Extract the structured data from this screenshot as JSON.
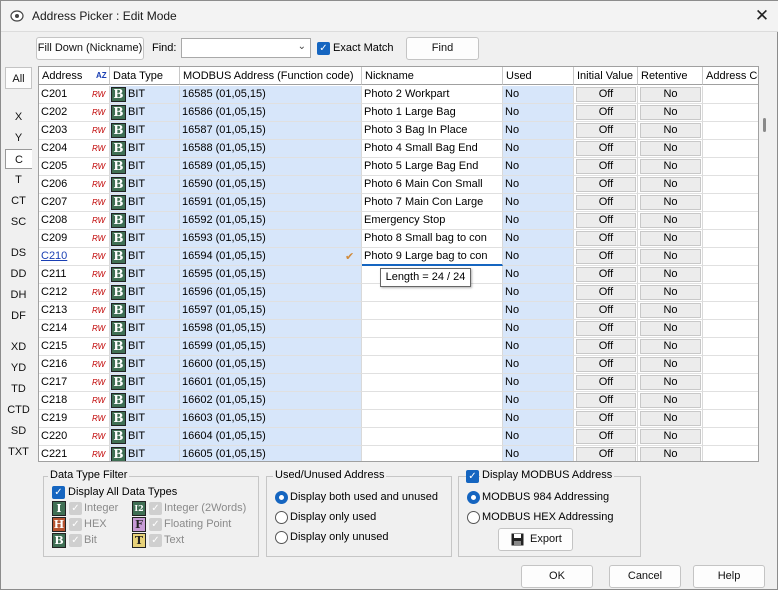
{
  "window": {
    "title": "Address Picker : Edit Mode",
    "close_glyph": "✕"
  },
  "toolbar": {
    "fill_down_label": "Fill Down (Nickname)",
    "find_label": "Find:",
    "find_value": "",
    "exact_match_label": "Exact Match",
    "exact_match_checked": true,
    "find_button_label": "Find"
  },
  "side_tabs": [
    "All",
    "X",
    "Y",
    "C",
    "T",
    "CT",
    "SC",
    "DS",
    "DD",
    "DH",
    "DF",
    "XD",
    "YD",
    "TD",
    "CTD",
    "SD",
    "TXT"
  ],
  "active_tab": "C",
  "grid": {
    "columns": [
      "Address",
      "Data Type",
      "MODBUS Address (Function code)",
      "Nickname",
      "Used",
      "Initial Value",
      "Retentive",
      "Address Co"
    ],
    "sort_icon": "AZ",
    "rw_badge": "RW",
    "type_icon_letter": "B",
    "rows": [
      {
        "address": "C201",
        "type": "BIT",
        "modbus": "16585 (01,05,15)",
        "nickname": "Photo 2 Workpart",
        "used": "No",
        "initial": "Off",
        "retentive": "No"
      },
      {
        "address": "C202",
        "type": "BIT",
        "modbus": "16586 (01,05,15)",
        "nickname": "Photo 1 Large Bag",
        "used": "No",
        "initial": "Off",
        "retentive": "No"
      },
      {
        "address": "C203",
        "type": "BIT",
        "modbus": "16587 (01,05,15)",
        "nickname": "Photo 3 Bag In Place",
        "used": "No",
        "initial": "Off",
        "retentive": "No"
      },
      {
        "address": "C204",
        "type": "BIT",
        "modbus": "16588 (01,05,15)",
        "nickname": "Photo 4 Small Bag End",
        "used": "No",
        "initial": "Off",
        "retentive": "No"
      },
      {
        "address": "C205",
        "type": "BIT",
        "modbus": "16589 (01,05,15)",
        "nickname": "Photo 5 Large Bag End",
        "used": "No",
        "initial": "Off",
        "retentive": "No"
      },
      {
        "address": "C206",
        "type": "BIT",
        "modbus": "16590 (01,05,15)",
        "nickname": "Photo 6 Main Con Small",
        "used": "No",
        "initial": "Off",
        "retentive": "No"
      },
      {
        "address": "C207",
        "type": "BIT",
        "modbus": "16591 (01,05,15)",
        "nickname": "Photo 7 Main Con Large",
        "used": "No",
        "initial": "Off",
        "retentive": "No"
      },
      {
        "address": "C208",
        "type": "BIT",
        "modbus": "16592 (01,05,15)",
        "nickname": "Emergency Stop",
        "used": "No",
        "initial": "Off",
        "retentive": "No"
      },
      {
        "address": "C209",
        "type": "BIT",
        "modbus": "16593 (01,05,15)",
        "nickname": "Photo 8 Small bag to con",
        "used": "No",
        "initial": "Off",
        "retentive": "No"
      },
      {
        "address": "C210",
        "type": "BIT",
        "modbus": "16594 (01,05,15)",
        "nickname": "Photo 9 Large bag to con",
        "used": "No",
        "initial": "Off",
        "retentive": "No"
      },
      {
        "address": "C211",
        "type": "BIT",
        "modbus": "16595 (01,05,15)",
        "nickname": "",
        "used": "No",
        "initial": "Off",
        "retentive": "No"
      },
      {
        "address": "C212",
        "type": "BIT",
        "modbus": "16596 (01,05,15)",
        "nickname": "",
        "used": "No",
        "initial": "Off",
        "retentive": "No"
      },
      {
        "address": "C213",
        "type": "BIT",
        "modbus": "16597 (01,05,15)",
        "nickname": "",
        "used": "No",
        "initial": "Off",
        "retentive": "No"
      },
      {
        "address": "C214",
        "type": "BIT",
        "modbus": "16598 (01,05,15)",
        "nickname": "",
        "used": "No",
        "initial": "Off",
        "retentive": "No"
      },
      {
        "address": "C215",
        "type": "BIT",
        "modbus": "16599 (01,05,15)",
        "nickname": "",
        "used": "No",
        "initial": "Off",
        "retentive": "No"
      },
      {
        "address": "C216",
        "type": "BIT",
        "modbus": "16600 (01,05,15)",
        "nickname": "",
        "used": "No",
        "initial": "Off",
        "retentive": "No"
      },
      {
        "address": "C217",
        "type": "BIT",
        "modbus": "16601 (01,05,15)",
        "nickname": "",
        "used": "No",
        "initial": "Off",
        "retentive": "No"
      },
      {
        "address": "C218",
        "type": "BIT",
        "modbus": "16602 (01,05,15)",
        "nickname": "",
        "used": "No",
        "initial": "Off",
        "retentive": "No"
      },
      {
        "address": "C219",
        "type": "BIT",
        "modbus": "16603 (01,05,15)",
        "nickname": "",
        "used": "No",
        "initial": "Off",
        "retentive": "No"
      },
      {
        "address": "C220",
        "type": "BIT",
        "modbus": "16604 (01,05,15)",
        "nickname": "",
        "used": "No",
        "initial": "Off",
        "retentive": "No"
      },
      {
        "address": "C221",
        "type": "BIT",
        "modbus": "16605 (01,05,15)",
        "nickname": "",
        "used": "No",
        "initial": "Off",
        "retentive": "No"
      }
    ],
    "editing_row": 9,
    "tooltip": "Length = 24 / 24"
  },
  "data_type_filter": {
    "title": "Data Type Filter",
    "display_all_label": "Display All Data Types",
    "items": [
      {
        "letter": "I",
        "label": "Integer",
        "color": "#3f6f54"
      },
      {
        "letter": "I2",
        "label": "Integer (2Words)",
        "color": "#3f6f54"
      },
      {
        "letter": "H",
        "label": "HEX",
        "color": "#b5522f"
      },
      {
        "letter": "F",
        "label": "Floating Point",
        "color": "#c79bd6"
      },
      {
        "letter": "B",
        "label": "Bit",
        "color": "#3f6f54"
      },
      {
        "letter": "T",
        "label": "Text",
        "color": "#e7d27a"
      }
    ]
  },
  "used_unused": {
    "title": "Used/Unused Address",
    "options": [
      "Display both used and unused",
      "Display only used",
      "Display only unused"
    ],
    "selected": 0
  },
  "modbus_display": {
    "title": "Display MODBUS Address",
    "checked": true,
    "options": [
      "MODBUS 984 Addressing",
      "MODBUS HEX Addressing"
    ],
    "selected": 0,
    "export_label": "Export"
  },
  "footer": {
    "ok_label": "OK",
    "cancel_label": "Cancel",
    "help_label": "Help"
  },
  "colors": {
    "accent": "#1565c0",
    "readonly_column": "#d7e6fa",
    "rw_badge": "#c00000"
  }
}
